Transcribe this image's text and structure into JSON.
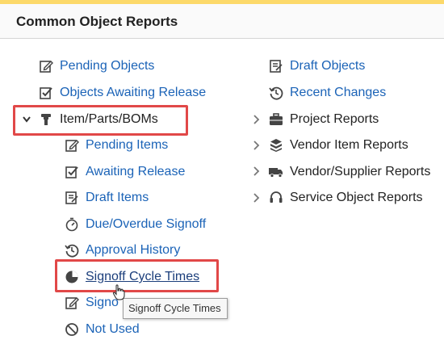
{
  "header": {
    "title": "Common Object Reports"
  },
  "left": {
    "top_items": [
      {
        "label": "Pending Objects",
        "icon": "edit-icon"
      },
      {
        "label": "Objects Awaiting Release",
        "icon": "checkbox-icon"
      }
    ],
    "group": {
      "label": "Item/Parts/BOMs",
      "icon": "part-icon",
      "expanded": true
    },
    "sub_items": [
      {
        "label": "Pending Items",
        "icon": "edit-icon"
      },
      {
        "label": "Awaiting Release",
        "icon": "checkbox-icon"
      },
      {
        "label": "Draft Items",
        "icon": "draft-icon"
      },
      {
        "label": "Due/Overdue Signoff",
        "icon": "timer-icon"
      },
      {
        "label": "Approval History",
        "icon": "history-icon"
      },
      {
        "label": "Signoff Cycle Times",
        "icon": "pie-chart-icon"
      },
      {
        "label": "Signo",
        "icon": "edit-icon"
      },
      {
        "label": "Not Used",
        "icon": "ban-icon"
      }
    ]
  },
  "right": {
    "items": [
      {
        "label": "Draft Objects",
        "icon": "draft-icon"
      },
      {
        "label": "Recent Changes",
        "icon": "history-icon"
      }
    ],
    "groups": [
      {
        "label": "Project Reports",
        "icon": "briefcase-icon"
      },
      {
        "label": "Vendor Item Reports",
        "icon": "cubes-icon"
      },
      {
        "label": "Vendor/Supplier Reports",
        "icon": "truck-icon"
      },
      {
        "label": "Service Object Reports",
        "icon": "headset-icon"
      }
    ]
  },
  "tooltip": {
    "text": "Signoff Cycle Times"
  },
  "colors": {
    "link": "#1b63b7",
    "highlight": "#e14848",
    "topbar": "#fcd96a"
  }
}
